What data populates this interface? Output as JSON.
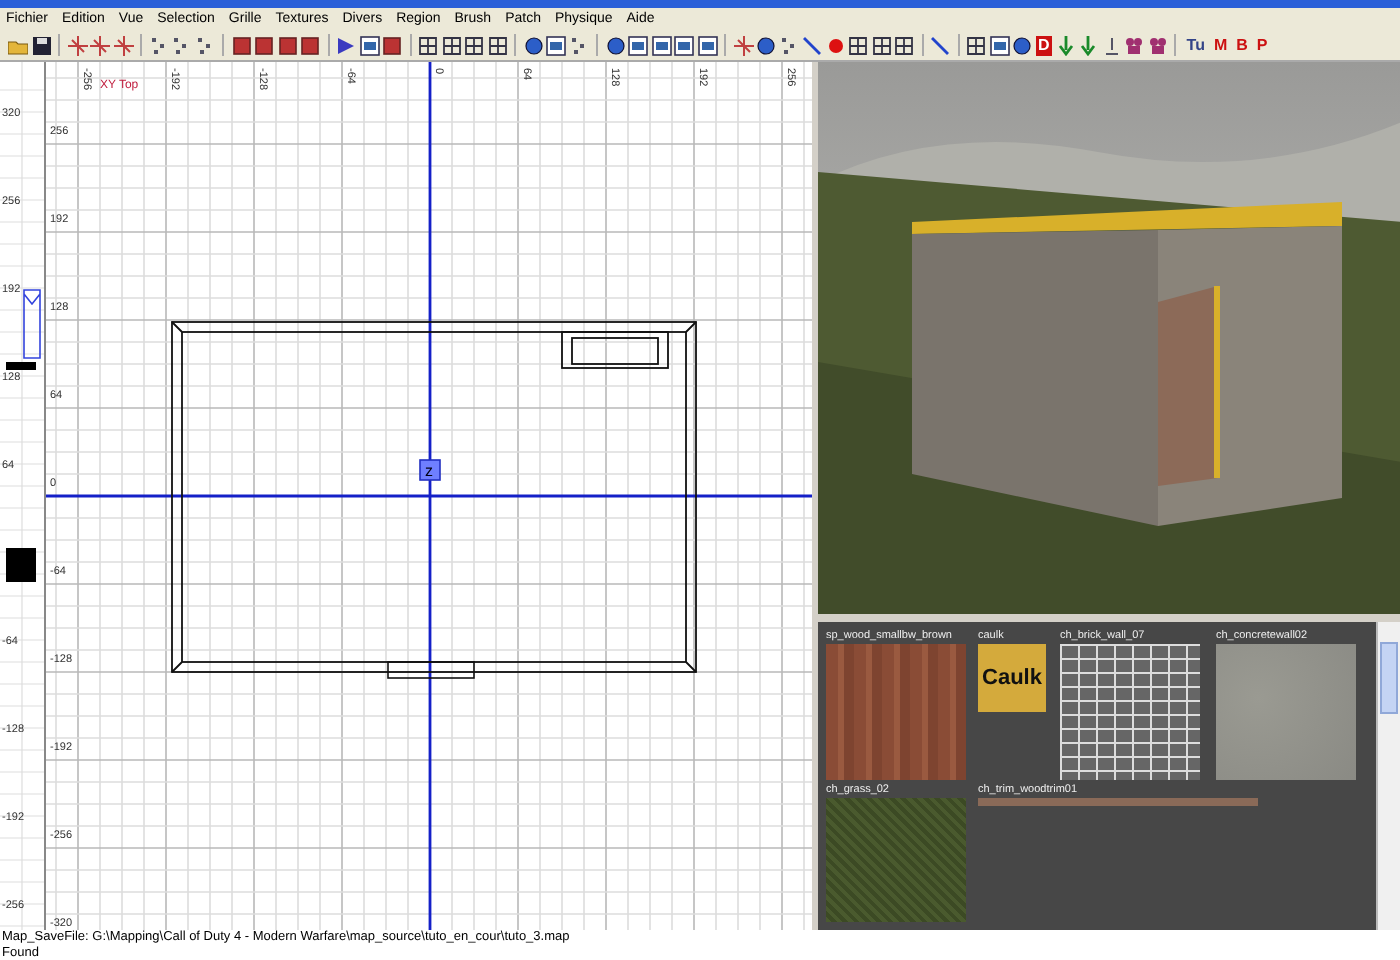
{
  "menu": {
    "items": [
      "Fichier",
      "Edition",
      "Vue",
      "Selection",
      "Grille",
      "Textures",
      "Divers",
      "Region",
      "Brush",
      "Patch",
      "Physique",
      "Aide"
    ]
  },
  "toolbar": {
    "letters": [
      {
        "label": "D",
        "kind": "badge",
        "color": "#cc1111"
      },
      {
        "label": "Tu",
        "kind": "plain",
        "color": "#334488"
      },
      {
        "label": "M",
        "kind": "plain",
        "color": "#cc1111"
      },
      {
        "label": "B",
        "kind": "plain",
        "color": "#cc1111"
      },
      {
        "label": "P",
        "kind": "plain",
        "color": "#cc1111"
      }
    ]
  },
  "z_ruler": {
    "labels": [
      "320",
      "256",
      "192",
      "128",
      "64",
      "-64",
      "-128",
      "-192",
      "-256"
    ]
  },
  "grid_view": {
    "view_label": "XY Top",
    "x_labels": [
      "-256",
      "-192",
      "-128",
      "-64",
      "0",
      "64",
      "128",
      "192",
      "256"
    ],
    "y_labels": [
      "256",
      "192",
      "128",
      "64",
      "0",
      "-64",
      "-128",
      "-192",
      "-256",
      "-320"
    ],
    "z_marker": "z"
  },
  "texture_browser": {
    "textures": [
      {
        "name": "sp_wood_smallbw_brown",
        "kind": "wood"
      },
      {
        "name": "caulk",
        "kind": "caulk",
        "caption": "Caulk"
      },
      {
        "name": "ch_brick_wall_07",
        "kind": "brick"
      },
      {
        "name": "ch_concretewall02",
        "kind": "concrete"
      },
      {
        "name": "ch_grass_02",
        "kind": "grass"
      },
      {
        "name": "ch_trim_woodtrim01",
        "kind": "trim"
      }
    ]
  },
  "status_bar": {
    "lines": [
      "Map_SaveFile: G:\\Mapping\\Call of Duty 4 - Modern Warfare\\map_source\\tuto_en_cour\\tuto_3.map",
      "Found"
    ]
  }
}
